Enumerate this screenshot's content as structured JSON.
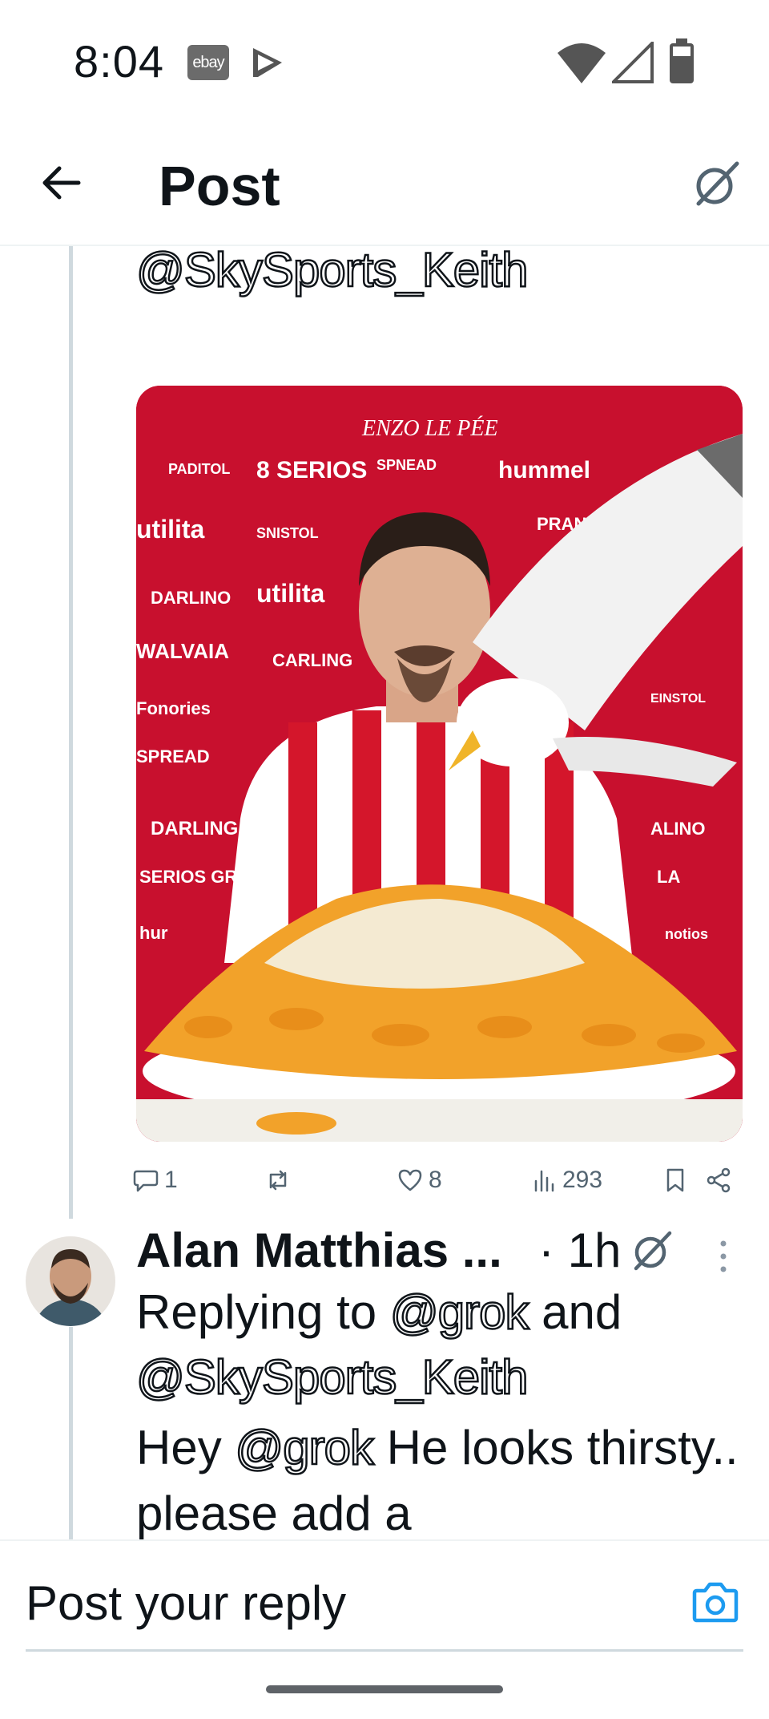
{
  "status_bar": {
    "time": "8:04",
    "ebay_badge": "ebay",
    "icons": [
      "play-store-icon",
      "wifi-icon",
      "signal-icon",
      "battery-icon"
    ]
  },
  "header": {
    "title": "Post",
    "back_icon": "arrow-left-icon",
    "right_icon": "grok-icon"
  },
  "parent_post": {
    "mention_line": "@SkySports_Keith",
    "image": {
      "banner_text": "ENZO LE PÉE",
      "sponsor_logos": [
        "hummel",
        "utilita",
        "CARLING",
        "Fonories",
        "SPREAD",
        "DARLING",
        "SERIOS GROUP"
      ],
      "colors": {
        "background": "#c8102e",
        "shirt_red": "#d4162b",
        "chips": "#f2a22a"
      }
    },
    "actions": {
      "replies": "1",
      "reposts": "",
      "likes": "8",
      "views": "293"
    }
  },
  "reply": {
    "author": "Alan Matthias ...",
    "time": "· 1h",
    "replying_prefix": "Replying to ",
    "replying_mention1": "@grok",
    "replying_and": " and",
    "replying_mention2": "@SkySports_Keith",
    "text_prefix": "Hey ",
    "text_mention": "@grok",
    "text_rest": " He looks thirsty.. please add a"
  },
  "compose": {
    "placeholder": "Post your reply",
    "camera_icon": "camera-icon"
  },
  "colors": {
    "link": "#1d9bf0",
    "muted": "#536471",
    "divider": "#eff3f4"
  }
}
